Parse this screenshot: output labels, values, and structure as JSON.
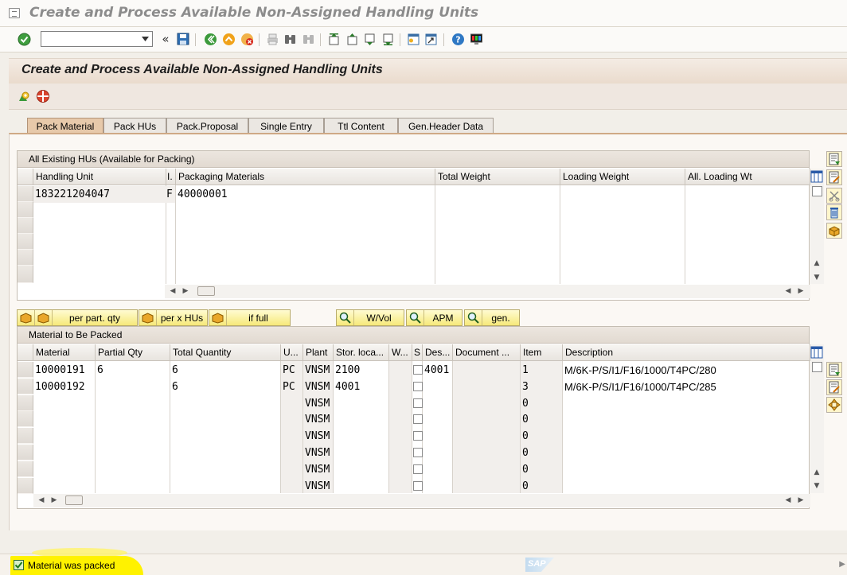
{
  "window": {
    "title": "Create and Process Available Non-Assigned Handling Units"
  },
  "toolbar": {
    "command_value": "",
    "icons": [
      "enter-icon",
      "save-icon",
      "back-icon",
      "exit-icon",
      "cancel-icon",
      "print-icon",
      "find-icon",
      "find-next-icon",
      "first-page-icon",
      "previous-page-icon",
      "next-page-icon",
      "last-page-icon",
      "create-session-icon",
      "shortcut-icon",
      "help-icon",
      "customize-layout-icon"
    ]
  },
  "app": {
    "title": "Create and Process Available Non-Assigned Handling Units"
  },
  "tabs": [
    {
      "label": "Pack Material",
      "active": true
    },
    {
      "label": "Pack HUs"
    },
    {
      "label": "Pack.Proposal"
    },
    {
      "label": "Single Entry"
    },
    {
      "label": "Ttl Content"
    },
    {
      "label": "Gen.Header Data"
    }
  ],
  "hu_table": {
    "title": "All Existing HUs (Available for Packing)",
    "columns": [
      "Handling Unit",
      "I.",
      "Packaging Materials",
      "Total Weight",
      "Loading Weight",
      "All. Loading Wt"
    ],
    "rows": [
      {
        "handling_unit": "183221204047",
        "indicator": "F",
        "packaging_material": "40000001",
        "total_weight": "",
        "loading_weight": "",
        "all_loading_wt": ""
      }
    ]
  },
  "pack_buttons": [
    {
      "label": "per part. qty"
    },
    {
      "label": "per x HUs"
    },
    {
      "label": "if full"
    },
    {
      "label": "W/Vol"
    },
    {
      "label": "APM"
    },
    {
      "label": "gen."
    }
  ],
  "material_table": {
    "title": "Material to Be Packed",
    "columns": [
      "Material",
      "Partial Qty",
      "Total Quantity",
      "U...",
      "Plant",
      "Stor. loca...",
      "W...",
      "S",
      "Des...",
      "Document ...",
      "Item",
      "Description"
    ],
    "rows": [
      {
        "material": "10000191",
        "partial_qty": "6",
        "total_qty": "6",
        "unit": "PC",
        "plant": "VNSM",
        "stor_loc": "2100",
        "dest": "4001",
        "document": "",
        "item": "1",
        "description": "M/6K-P/S/I1/F16/1000/T4PC/280"
      },
      {
        "material": "10000192",
        "partial_qty": "",
        "total_qty": "6",
        "unit": "PC",
        "plant": "VNSM",
        "stor_loc": "4001",
        "dest": "",
        "document": "",
        "item": "3",
        "description": "M/6K-P/S/I1/F16/1000/T4PC/285"
      },
      {
        "material": "",
        "partial_qty": "",
        "total_qty": "",
        "unit": "",
        "plant": "VNSM",
        "stor_loc": "",
        "dest": "",
        "document": "",
        "item": "0",
        "description": ""
      },
      {
        "material": "",
        "partial_qty": "",
        "total_qty": "",
        "unit": "",
        "plant": "VNSM",
        "stor_loc": "",
        "dest": "",
        "document": "",
        "item": "0",
        "description": ""
      },
      {
        "material": "",
        "partial_qty": "",
        "total_qty": "",
        "unit": "",
        "plant": "VNSM",
        "stor_loc": "",
        "dest": "",
        "document": "",
        "item": "0",
        "description": ""
      },
      {
        "material": "",
        "partial_qty": "",
        "total_qty": "",
        "unit": "",
        "plant": "VNSM",
        "stor_loc": "",
        "dest": "",
        "document": "",
        "item": "0",
        "description": ""
      },
      {
        "material": "",
        "partial_qty": "",
        "total_qty": "",
        "unit": "",
        "plant": "VNSM",
        "stor_loc": "",
        "dest": "",
        "document": "",
        "item": "0",
        "description": ""
      },
      {
        "material": "",
        "partial_qty": "",
        "total_qty": "",
        "unit": "",
        "plant": "VNSM",
        "stor_loc": "",
        "dest": "",
        "document": "",
        "item": "0",
        "description": ""
      }
    ]
  },
  "status": {
    "message": "Material was packed",
    "type": "success",
    "logo": "SAP"
  },
  "colors": {
    "tab_active": "#e7c9aa",
    "highlight": "#fff200",
    "button_yellow": "#f6e97a"
  }
}
